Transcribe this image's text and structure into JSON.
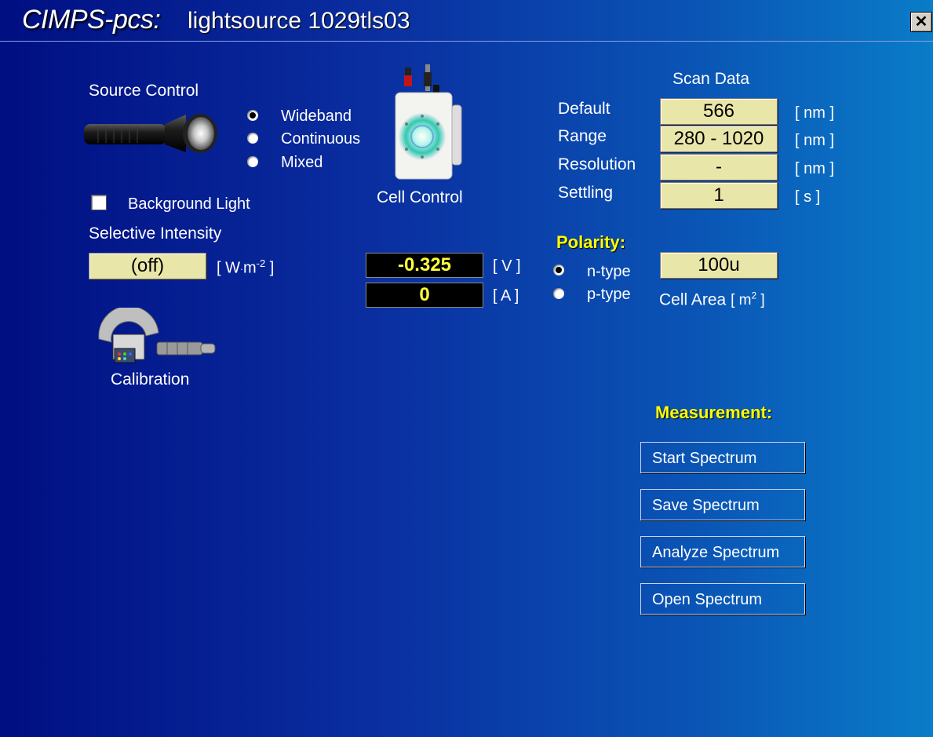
{
  "window": {
    "app_name": "CIMPS-pcs:",
    "title": "lightsource 1029tls03",
    "close_glyph": "✕"
  },
  "source_control": {
    "heading": "Source Control",
    "icon": "flashlight-icon",
    "modes": [
      {
        "label": "Wideband",
        "selected": true
      },
      {
        "label": "Continuous",
        "selected": false
      },
      {
        "label": "Mixed",
        "selected": false
      }
    ],
    "background_light": {
      "label": "Background Light",
      "checked": false
    },
    "selective_intensity": {
      "label": "Selective Intensity",
      "value": "(off)",
      "unit_prefix": "[ W",
      "unit_dot": "·",
      "unit_m": "m",
      "unit_exp": "-2",
      "unit_suffix": "]"
    }
  },
  "cell_control": {
    "label": "Cell Control",
    "icon": "cell-holder-icon",
    "voltage": {
      "value": "-0.325",
      "unit": "[ V ]"
    },
    "current": {
      "value": "0",
      "unit": "[ A ]"
    }
  },
  "calibration": {
    "label": "Calibration",
    "icon": "micrometer-icon"
  },
  "scan_data": {
    "heading": "Scan Data",
    "rows": [
      {
        "label": "Default",
        "value": "566",
        "unit": "[ nm ]"
      },
      {
        "label": "Range",
        "value": "280 - 1020",
        "unit": "[ nm ]"
      },
      {
        "label": "Resolution",
        "value": "-",
        "unit": "[ nm ]"
      },
      {
        "label": "Settling",
        "value": "1",
        "unit": "[ s ]"
      }
    ]
  },
  "polarity": {
    "heading": "Polarity:",
    "options": [
      {
        "label": "n-type",
        "selected": true
      },
      {
        "label": "p-type",
        "selected": false
      }
    ]
  },
  "cell_area": {
    "value": "100u",
    "label": "Cell Area",
    "unit_prefix": "[ m",
    "unit_exp": "2",
    "unit_suffix": "]"
  },
  "measurement": {
    "heading": "Measurement:",
    "buttons": [
      "Start Spectrum",
      "Save Spectrum",
      "Analyze Spectrum",
      "Open Spectrum"
    ]
  },
  "colors": {
    "field_bg": "#e9e6a9",
    "readout_text": "#ffff3c",
    "heading_yellow": "#ffff00"
  }
}
